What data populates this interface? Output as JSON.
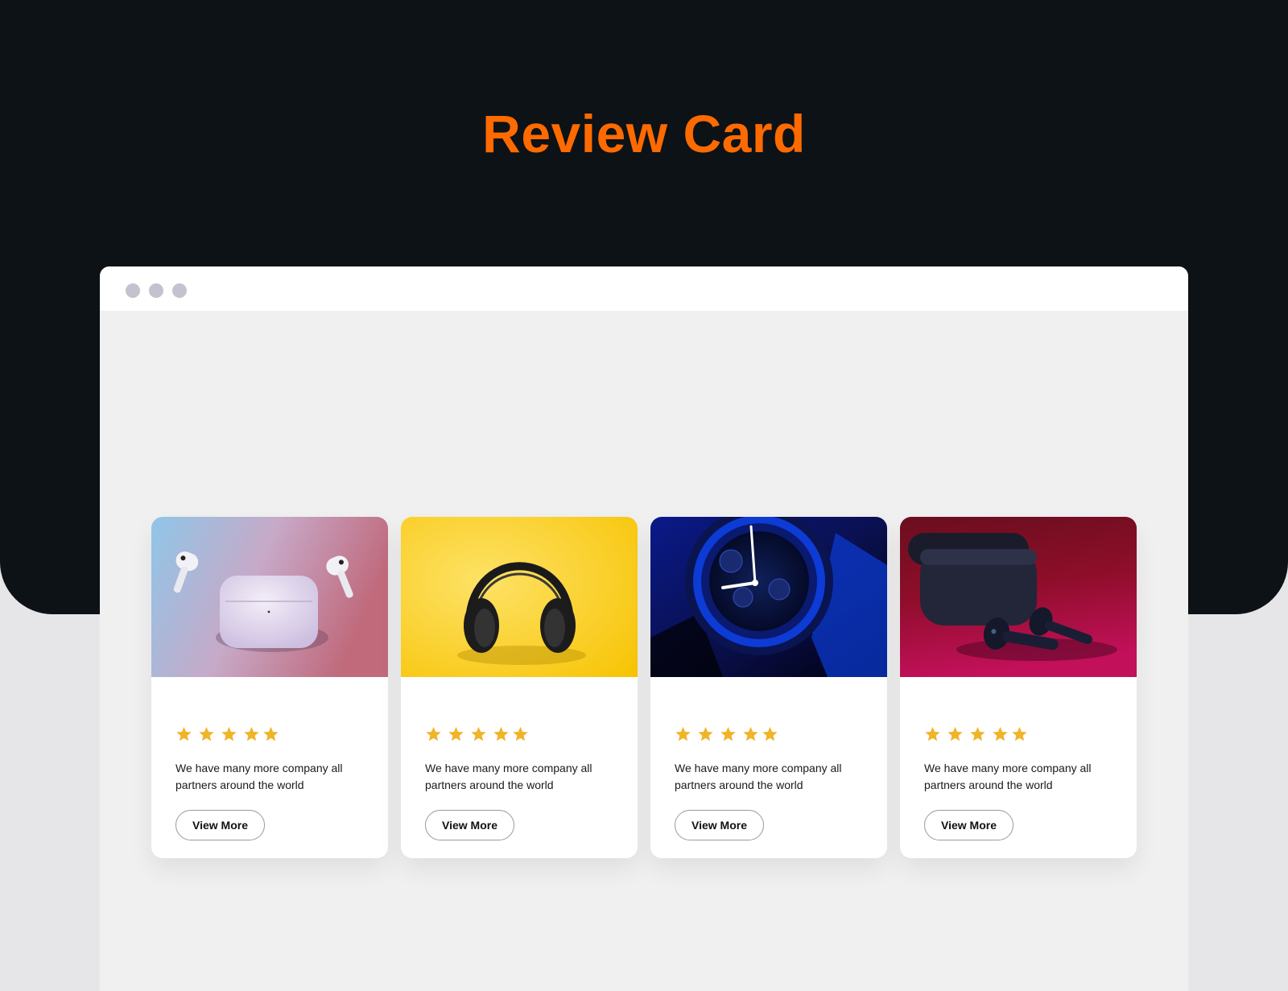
{
  "page": {
    "title": "Review Card",
    "title_color": "#ff6a00",
    "hero_color": "#0d1216",
    "star_color": "#f0b429"
  },
  "browser": {
    "window_dots": 3
  },
  "cards": [
    {
      "image": "airpods-pro-image",
      "rating": 5,
      "text": "We have many more company all partners around the world",
      "button_label": "View More"
    },
    {
      "image": "headphones-image",
      "rating": 5,
      "text": "We have many more company all partners around the world",
      "button_label": "View More"
    },
    {
      "image": "smartwatch-image",
      "rating": 5,
      "text": "We have many more company all partners around the world",
      "button_label": "View More"
    },
    {
      "image": "wireless-earbuds-image",
      "rating": 5,
      "text": "We have many more company all partners around the world",
      "button_label": "View More"
    }
  ]
}
